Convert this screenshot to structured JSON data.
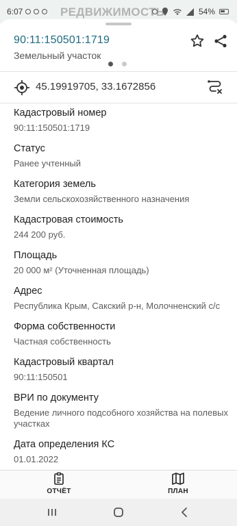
{
  "status_bar": {
    "time": "6:07",
    "battery": "54%",
    "app_watermark": "РЕДВИЖИМОСТЬ"
  },
  "header": {
    "title": "90:11:150501:1719",
    "subtitle": "Земельный участок",
    "icons": [
      "star-icon",
      "share-icon"
    ]
  },
  "coordinates": {
    "text": "45.19919705, 33.1672856",
    "icons": [
      "location-target-icon",
      "route-icon"
    ]
  },
  "fields": [
    {
      "label": "Кадастровый номер",
      "value": "90:11:150501:1719"
    },
    {
      "label": "Статус",
      "value": "Ранее учтенный"
    },
    {
      "label": "Категория земель",
      "value": "Земли сельскохозяйственного назначения"
    },
    {
      "label": "Кадастровая стоимость",
      "value": "244 200 руб."
    },
    {
      "label": "Площадь",
      "value": "20 000 м² (Уточненная площадь)"
    },
    {
      "label": "Адрес",
      "value": "Республика Крым, Сакский р-н, Молочненский с/с"
    },
    {
      "label": "Форма собственности",
      "value": "Частная собственность"
    },
    {
      "label": "Кадастровый квартал",
      "value": "90:11:150501"
    },
    {
      "label": "ВРИ по документу",
      "value": "Ведение личного подсобного хозяйства на полевых участках"
    },
    {
      "label": "Дата определения КС",
      "value": "01.01.2022"
    }
  ],
  "tabs": [
    {
      "label": "ОТЧЁТ",
      "icon": "report-icon"
    },
    {
      "label": "ПЛАН",
      "icon": "map-icon"
    }
  ],
  "colors": {
    "title": "#1e6a7e",
    "status_bar": "#eef3f1"
  }
}
